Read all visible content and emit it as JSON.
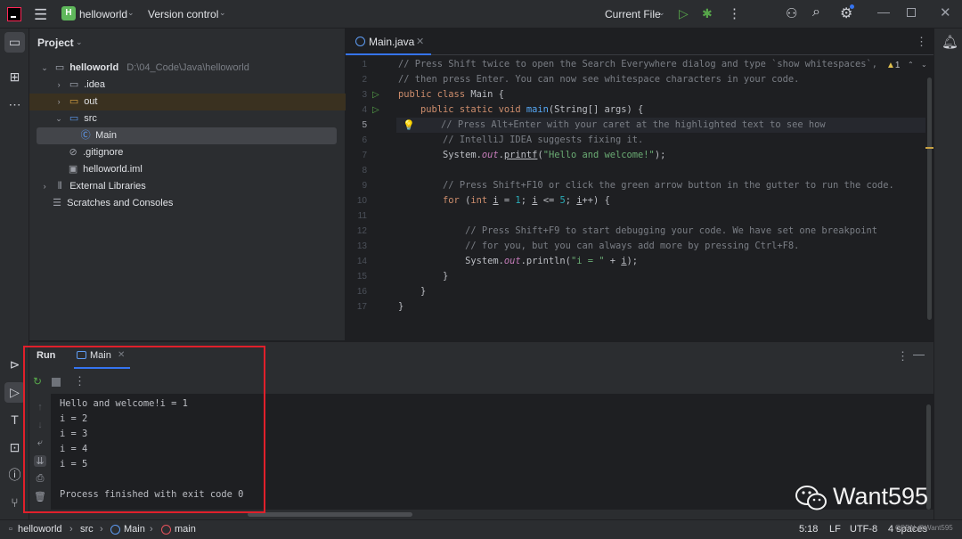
{
  "titlebar": {
    "project_badge": "H",
    "project_name": "helloworld",
    "version_control": "Version control",
    "run_config": "Current File"
  },
  "project_pane": {
    "title": "Project",
    "tree": [
      {
        "label": "helloworld",
        "path": "D:\\04_Code\\Java\\helloworld"
      },
      {
        "label": ".idea"
      },
      {
        "label": "out"
      },
      {
        "label": "src"
      },
      {
        "label": "Main"
      },
      {
        "label": ".gitignore"
      },
      {
        "label": "helloworld.iml"
      },
      {
        "label": "External Libraries"
      },
      {
        "label": "Scratches and Consoles"
      }
    ]
  },
  "editor": {
    "tab": "Main.java",
    "warning_count": "1",
    "current_line": "5",
    "line_numbers": [
      "1",
      "2",
      "3",
      "4",
      "5",
      "6",
      "7",
      "8",
      "9",
      "10",
      "11",
      "12",
      "13",
      "14",
      "15",
      "16",
      "17"
    ]
  },
  "run_panel": {
    "title": "Run",
    "tab": "Main",
    "output": [
      "Hello and welcome!i = 1",
      "i = 2",
      "i = 3",
      "i = 4",
      "i = 5",
      "",
      "Process finished with exit code 0"
    ]
  },
  "statusbar": {
    "crumbs": [
      "helloworld",
      "src",
      "Main",
      "main"
    ],
    "position": "5:18",
    "line_sep": "LF",
    "encoding": "UTF-8",
    "indent": "4 spaces"
  },
  "watermark": {
    "text": "Want595",
    "small": "CSDN @Want595"
  },
  "colors": {
    "accent": "#3574f0",
    "run_green": "#57a64a",
    "highlight_box": "#e0202b"
  }
}
